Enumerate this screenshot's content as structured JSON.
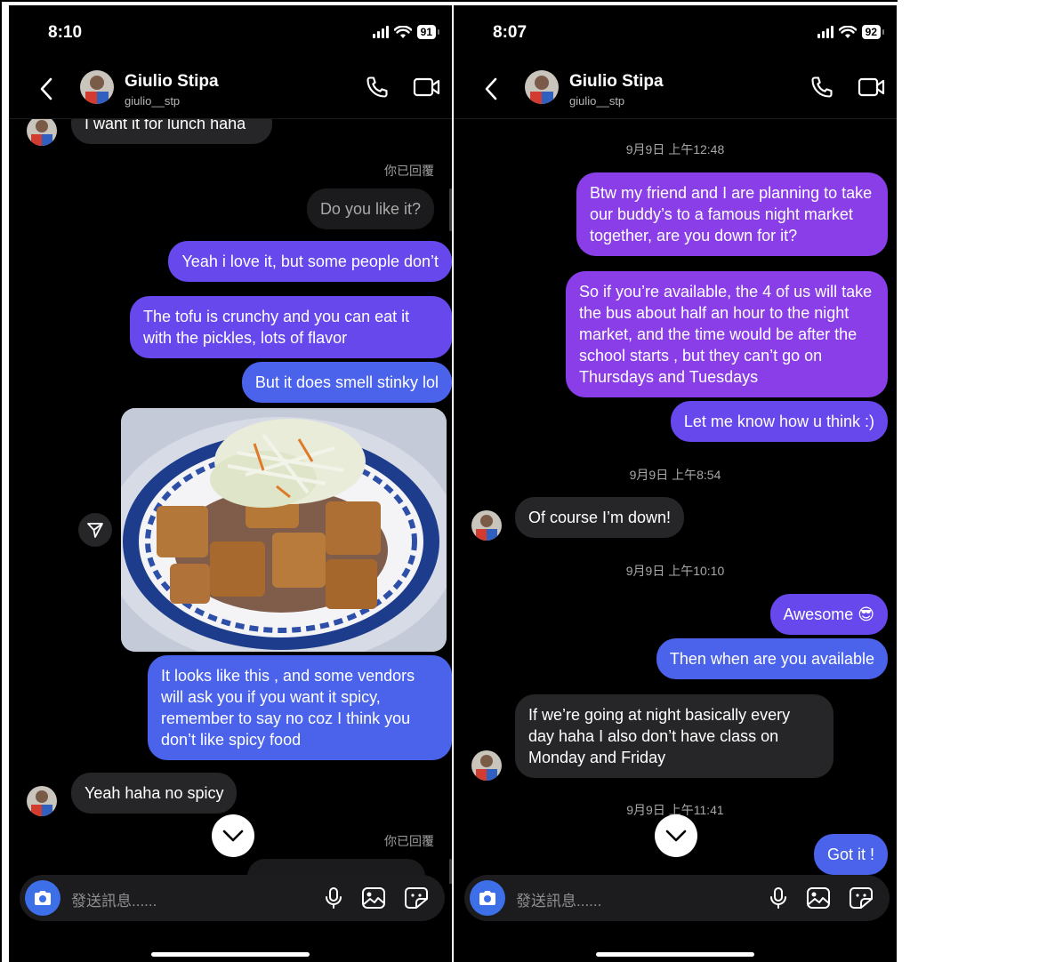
{
  "left": {
    "status": {
      "time": "8:10",
      "battery": "91"
    },
    "header": {
      "name": "Giulio Stipa",
      "handle": "giulio__stp"
    },
    "messages": {
      "partial_top": "I want it for lunch haha",
      "replied_label_1": "你已回覆",
      "reply_quote_1": "Do you like it?",
      "m1": "Yeah i love it, but some people don’t",
      "m2": "The tofu is crunchy and you can eat it with the pickles, lots of flavor",
      "m3": "But it does smell stinky lol",
      "m4": "It looks like this , and some vendors will ask you if you want it spicy, remember to say no coz I think you don’t like spicy food",
      "r1": "Yeah haha no spicy",
      "replied_label_2": "你已回覆"
    },
    "composer": {
      "placeholder": "發送訊息......"
    }
  },
  "right": {
    "status": {
      "time": "8:07",
      "battery": "92"
    },
    "header": {
      "name": "Giulio Stipa",
      "handle": "giulio__stp"
    },
    "messages": {
      "ts1": "9月9日 上午12:48",
      "m1": "Btw my friend and I are planning to take our buddy’s to a famous night market together, are you down for it?",
      "m2": "So if you’re available, the 4 of us will take the bus about half an hour to the night market, and the time would be after the school starts , but they can’t go on Thursdays and Tuesdays",
      "m3": "Let me know how u think :)",
      "ts2": "9月9日 上午8:54",
      "r1": "Of course I’m down!",
      "ts3": "9月9日 上午10:10",
      "m4": "Awesome",
      "m4_emoji": "😎",
      "m5": "Then when are you available",
      "r2": "If we’re going at night basically every day haha I also don’t have class on Monday and Friday",
      "ts4": "9月9日 上午11:41",
      "m6": "Got it !"
    },
    "composer": {
      "placeholder": "發送訊息......"
    }
  },
  "colors": {
    "purple": "#8a3ee8",
    "indigo": "#6648ec",
    "blue": "#4a63ea",
    "gray": "#262628",
    "camera": "#3c6fe8"
  }
}
